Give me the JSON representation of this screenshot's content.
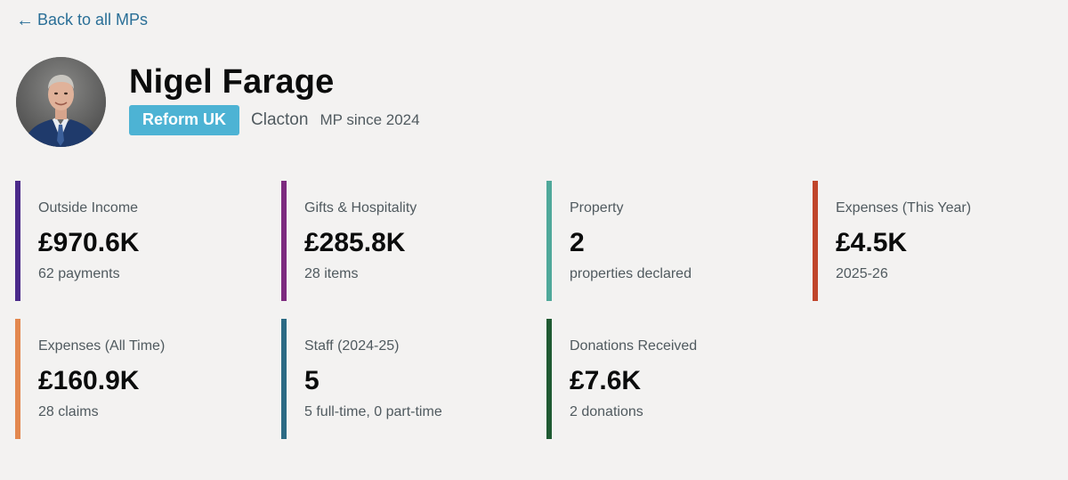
{
  "nav": {
    "back_arrow": "←",
    "back_label": "Back to all MPs"
  },
  "mp": {
    "name": "Nigel Farage",
    "party": "Reform UK",
    "party_color": "#4db3d4",
    "constituency": "Clacton",
    "since": "MP since 2024"
  },
  "cards": [
    {
      "label": "Outside Income",
      "value": "£970.6K",
      "sub": "62 payments",
      "color": "#4b2a8a"
    },
    {
      "label": "Gifts & Hospitality",
      "value": "£285.8K",
      "sub": "28 items",
      "color": "#7d2a7f"
    },
    {
      "label": "Property",
      "value": "2",
      "sub": "properties declared",
      "color": "#4fa89a"
    },
    {
      "label": "Expenses (This Year)",
      "value": "£4.5K",
      "sub": "2025-26",
      "color": "#c0452b"
    },
    {
      "label": "Expenses (All Time)",
      "value": "£160.9K",
      "sub": "28 claims",
      "color": "#e3884f"
    },
    {
      "label": "Staff (2024-25)",
      "value": "5",
      "sub": "5 full-time, 0 part-time",
      "color": "#2b6a84"
    },
    {
      "label": "Donations Received",
      "value": "£7.6K",
      "sub": "2 donations",
      "color": "#1f5a32"
    }
  ]
}
